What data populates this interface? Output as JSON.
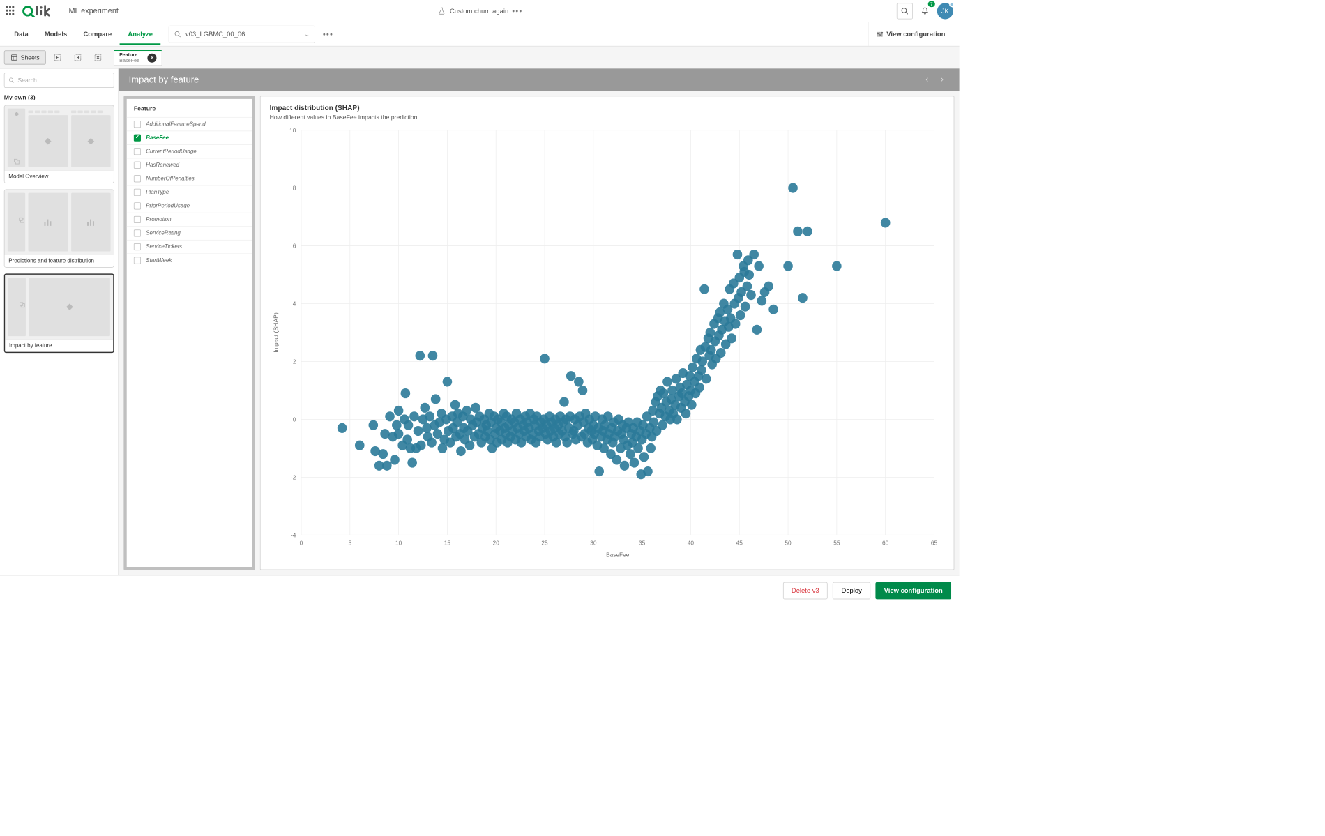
{
  "header": {
    "app_title": "ML experiment",
    "doc_title": "Custom churn again",
    "notification_count": "7",
    "avatar_initials": "JK"
  },
  "tabs": {
    "items": [
      "Data",
      "Models",
      "Compare",
      "Analyze"
    ],
    "active_index": 3,
    "search_value": "v03_LGBMC_00_06",
    "view_config_label": "View configuration"
  },
  "toolbar": {
    "sheets_label": "Sheets",
    "feature_tab_title": "Feature",
    "feature_tab_sub": "BaseFee"
  },
  "sidebar": {
    "search_placeholder": "Search",
    "my_own_label": "My own (3)",
    "sheets": [
      {
        "label": "Model Overview"
      },
      {
        "label": "Predictions and feature distribution"
      },
      {
        "label": "Impact by feature"
      }
    ],
    "active_sheet": 2
  },
  "grey_header": {
    "title": "Impact by feature"
  },
  "feature_panel": {
    "title": "Feature",
    "items": [
      "AdditionalFeatureSpend",
      "BaseFee",
      "CurrentPeriodUsage",
      "HasRenewed",
      "NumberOfPenalties",
      "PlanType",
      "PriorPeriodUsage",
      "Promotion",
      "ServiceRating",
      "ServiceTickets",
      "StartWeek"
    ],
    "selected": "BaseFee"
  },
  "chart": {
    "title": "Impact distribution (SHAP)",
    "subtitle": "How different values in BaseFee impacts the prediction.",
    "xlabel": "BaseFee",
    "ylabel": "Impact (SHAP)"
  },
  "footer": {
    "delete_label": "Delete v3",
    "deploy_label": "Deploy",
    "view_config_label": "View configuration"
  },
  "chart_data": {
    "type": "scatter",
    "title": "Impact distribution (SHAP)",
    "xlabel": "BaseFee",
    "ylabel": "Impact (SHAP)",
    "xlim": [
      0,
      65
    ],
    "ylim": [
      -4,
      10
    ],
    "xticks": [
      0,
      5,
      10,
      15,
      20,
      25,
      30,
      35,
      40,
      45,
      50,
      55,
      60,
      65
    ],
    "yticks": [
      -4,
      -2,
      0,
      2,
      4,
      6,
      8,
      10
    ],
    "point_color": "#2b7a99",
    "points": [
      [
        4.2,
        -0.3
      ],
      [
        6.0,
        -0.9
      ],
      [
        7.4,
        -0.2
      ],
      [
        7.6,
        -1.1
      ],
      [
        8.0,
        -1.6
      ],
      [
        8.4,
        -1.2
      ],
      [
        8.6,
        -0.5
      ],
      [
        8.8,
        -1.6
      ],
      [
        9.1,
        0.1
      ],
      [
        9.4,
        -0.6
      ],
      [
        9.6,
        -1.4
      ],
      [
        9.8,
        -0.2
      ],
      [
        10,
        -0.5
      ],
      [
        10,
        0.3
      ],
      [
        10.4,
        -0.9
      ],
      [
        10.6,
        0.0
      ],
      [
        10.7,
        0.9
      ],
      [
        10.9,
        -0.7
      ],
      [
        11,
        -0.2
      ],
      [
        11.2,
        -1.0
      ],
      [
        11.4,
        -1.5
      ],
      [
        11.6,
        0.1
      ],
      [
        11.8,
        -1.0
      ],
      [
        12,
        -0.4
      ],
      [
        12.2,
        2.2
      ],
      [
        12.3,
        -0.9
      ],
      [
        12.5,
        0.0
      ],
      [
        12.7,
        0.4
      ],
      [
        12.9,
        -0.3
      ],
      [
        13,
        -0.6
      ],
      [
        13.2,
        0.1
      ],
      [
        13.4,
        -0.8
      ],
      [
        13.5,
        2.2
      ],
      [
        13.7,
        -0.2
      ],
      [
        13.8,
        0.7
      ],
      [
        14,
        -0.5
      ],
      [
        14.2,
        -0.1
      ],
      [
        14.4,
        0.2
      ],
      [
        14.5,
        -1.0
      ],
      [
        14.7,
        -0.7
      ],
      [
        14.9,
        0.0
      ],
      [
        15,
        1.3
      ],
      [
        15.1,
        -0.4
      ],
      [
        15.3,
        -0.8
      ],
      [
        15.5,
        0.1
      ],
      [
        15.6,
        -0.3
      ],
      [
        15.8,
        0.5
      ],
      [
        15.9,
        -0.6
      ],
      [
        16,
        -0.1
      ],
      [
        16.1,
        0.2
      ],
      [
        16.3,
        -0.5
      ],
      [
        16.4,
        -1.1
      ],
      [
        16.6,
        0.1
      ],
      [
        16.7,
        -0.3
      ],
      [
        16.8,
        -0.7
      ],
      [
        17,
        0.3
      ],
      [
        17.1,
        -0.4
      ],
      [
        17.3,
        -0.9
      ],
      [
        17.4,
        0.0
      ],
      [
        17.6,
        -0.2
      ],
      [
        17.8,
        -0.6
      ],
      [
        17.9,
        0.4
      ],
      [
        18,
        -0.1
      ],
      [
        18.2,
        -0.5
      ],
      [
        18.3,
        0.1
      ],
      [
        18.5,
        -0.8
      ],
      [
        18.6,
        -0.3
      ],
      [
        18.8,
        0.0
      ],
      [
        18.9,
        -0.6
      ],
      [
        19,
        -0.2
      ],
      [
        19.1,
        -0.4
      ],
      [
        19.3,
        0.2
      ],
      [
        19.4,
        -0.7
      ],
      [
        19.5,
        -0.1
      ],
      [
        19.6,
        -1.0
      ],
      [
        19.8,
        0.1
      ],
      [
        19.9,
        -0.5
      ],
      [
        20,
        -0.3
      ],
      [
        20.1,
        -0.8
      ],
      [
        20.2,
        0.0
      ],
      [
        20.4,
        -0.4
      ],
      [
        20.5,
        -0.1
      ],
      [
        20.6,
        -0.7
      ],
      [
        20.8,
        0.2
      ],
      [
        20.9,
        -0.3
      ],
      [
        21,
        -0.5
      ],
      [
        21.1,
        0.1
      ],
      [
        21.2,
        -0.8
      ],
      [
        21.3,
        -0.2
      ],
      [
        21.5,
        -0.6
      ],
      [
        21.6,
        0.0
      ],
      [
        21.7,
        -0.4
      ],
      [
        21.9,
        -0.1
      ],
      [
        22,
        -0.7
      ],
      [
        22.1,
        0.2
      ],
      [
        22.2,
        -0.3
      ],
      [
        22.4,
        -0.5
      ],
      [
        22.5,
        0.0
      ],
      [
        22.6,
        -0.8
      ],
      [
        22.8,
        -0.2
      ],
      [
        22.9,
        -0.4
      ],
      [
        23,
        0.1
      ],
      [
        23.1,
        -0.6
      ],
      [
        23.2,
        -0.1
      ],
      [
        23.4,
        -0.3
      ],
      [
        23.5,
        0.2
      ],
      [
        23.6,
        -0.7
      ],
      [
        23.8,
        -0.5
      ],
      [
        23.9,
        0.0
      ],
      [
        24,
        -0.2
      ],
      [
        24.1,
        -0.8
      ],
      [
        24.2,
        0.1
      ],
      [
        24.4,
        -0.4
      ],
      [
        24.5,
        -0.6
      ],
      [
        24.6,
        -0.1
      ],
      [
        24.8,
        -0.3
      ],
      [
        24.9,
        0.0
      ],
      [
        25,
        2.1
      ],
      [
        25.1,
        -0.5
      ],
      [
        25.2,
        -0.2
      ],
      [
        25.3,
        -0.7
      ],
      [
        25.5,
        0.1
      ],
      [
        25.6,
        -0.4
      ],
      [
        25.7,
        -0.1
      ],
      [
        25.9,
        -0.6
      ],
      [
        26,
        -0.3
      ],
      [
        26.1,
        0.0
      ],
      [
        26.2,
        -0.8
      ],
      [
        26.4,
        -0.2
      ],
      [
        26.5,
        -0.5
      ],
      [
        26.6,
        0.1
      ],
      [
        26.8,
        -0.4
      ],
      [
        26.9,
        -0.1
      ],
      [
        27,
        0.6
      ],
      [
        27.1,
        -0.6
      ],
      [
        27.2,
        0.0
      ],
      [
        27.3,
        -0.8
      ],
      [
        27.5,
        -0.3
      ],
      [
        27.6,
        0.1
      ],
      [
        27.7,
        1.5
      ],
      [
        27.9,
        -0.5
      ],
      [
        28,
        -0.4
      ],
      [
        28.1,
        0.0
      ],
      [
        28.2,
        -0.7
      ],
      [
        28.4,
        -0.2
      ],
      [
        28.5,
        1.3
      ],
      [
        28.6,
        0.1
      ],
      [
        28.8,
        -0.6
      ],
      [
        28.9,
        1.0
      ],
      [
        29,
        -0.1
      ],
      [
        29.1,
        -0.5
      ],
      [
        29.2,
        0.2
      ],
      [
        29.4,
        -0.8
      ],
      [
        29.5,
        -0.3
      ],
      [
        29.6,
        0.0
      ],
      [
        29.8,
        -0.4
      ],
      [
        29.9,
        -0.7
      ],
      [
        30,
        -0.2
      ],
      [
        30.1,
        -0.5
      ],
      [
        30.2,
        0.1
      ],
      [
        30.4,
        -0.9
      ],
      [
        30.5,
        -0.3
      ],
      [
        30.6,
        -1.8
      ],
      [
        30.8,
        -0.6
      ],
      [
        30.9,
        0.0
      ],
      [
        31,
        -0.4
      ],
      [
        31.1,
        -1.0
      ],
      [
        31.2,
        -0.2
      ],
      [
        31.4,
        -0.7
      ],
      [
        31.5,
        0.1
      ],
      [
        31.6,
        -0.5
      ],
      [
        31.8,
        -1.2
      ],
      [
        31.9,
        -0.3
      ],
      [
        32,
        -0.8
      ],
      [
        32.1,
        -0.1
      ],
      [
        32.2,
        -0.6
      ],
      [
        32.4,
        -1.4
      ],
      [
        32.5,
        -0.4
      ],
      [
        32.6,
        0.0
      ],
      [
        32.8,
        -1.0
      ],
      [
        32.9,
        -0.5
      ],
      [
        33,
        -0.2
      ],
      [
        33.1,
        -0.7
      ],
      [
        33.2,
        -1.6
      ],
      [
        33.4,
        -0.3
      ],
      [
        33.5,
        -0.9
      ],
      [
        33.6,
        -0.1
      ],
      [
        33.8,
        -1.2
      ],
      [
        33.9,
        -0.5
      ],
      [
        34,
        -0.8
      ],
      [
        34.1,
        -0.3
      ],
      [
        34.2,
        -1.5
      ],
      [
        34.4,
        -0.6
      ],
      [
        34.5,
        -0.1
      ],
      [
        34.6,
        -1.0
      ],
      [
        34.8,
        -0.4
      ],
      [
        34.9,
        -1.9
      ],
      [
        35,
        -0.7
      ],
      [
        35.1,
        -0.2
      ],
      [
        35.2,
        -1.3
      ],
      [
        35.4,
        -0.5
      ],
      [
        35.5,
        0.1
      ],
      [
        35.6,
        -1.8
      ],
      [
        35.8,
        -0.3
      ],
      [
        35.9,
        -1.0
      ],
      [
        36,
        -0.6
      ],
      [
        36.1,
        0.3
      ],
      [
        36.2,
        -0.1
      ],
      [
        36.4,
        0.6
      ],
      [
        36.5,
        -0.4
      ],
      [
        36.6,
        0.8
      ],
      [
        36.8,
        0.2
      ],
      [
        36.9,
        1.0
      ],
      [
        37,
        0.4
      ],
      [
        37.1,
        -0.2
      ],
      [
        37.2,
        0.9
      ],
      [
        37.4,
        0.1
      ],
      [
        37.5,
        0.6
      ],
      [
        37.6,
        1.3
      ],
      [
        37.8,
        0.3
      ],
      [
        37.9,
        0.0
      ],
      [
        38,
        0.7
      ],
      [
        38.1,
        1.0
      ],
      [
        38.2,
        0.2
      ],
      [
        38.4,
        0.5
      ],
      [
        38.5,
        1.4
      ],
      [
        38.6,
        0.0
      ],
      [
        38.8,
        0.8
      ],
      [
        38.9,
        1.1
      ],
      [
        39,
        0.4
      ],
      [
        39.1,
        0.9
      ],
      [
        39.2,
        1.6
      ],
      [
        39.4,
        0.6
      ],
      [
        39.5,
        0.2
      ],
      [
        39.6,
        1.2
      ],
      [
        39.8,
        0.8
      ],
      [
        39.9,
        1.5
      ],
      [
        40,
        1.0
      ],
      [
        40.1,
        0.5
      ],
      [
        40.2,
        1.8
      ],
      [
        40.4,
        1.3
      ],
      [
        40.5,
        0.9
      ],
      [
        40.6,
        2.1
      ],
      [
        40.8,
        1.5
      ],
      [
        40.9,
        1.1
      ],
      [
        41,
        2.4
      ],
      [
        41.1,
        1.7
      ],
      [
        41.2,
        2.0
      ],
      [
        41.4,
        4.5
      ],
      [
        41.5,
        2.5
      ],
      [
        41.6,
        1.4
      ],
      [
        41.8,
        2.8
      ],
      [
        41.9,
        2.2
      ],
      [
        42,
        3.0
      ],
      [
        42.1,
        2.4
      ],
      [
        42.2,
        1.9
      ],
      [
        42.4,
        3.3
      ],
      [
        42.5,
        2.7
      ],
      [
        42.6,
        2.1
      ],
      [
        42.8,
        3.5
      ],
      [
        42.9,
        2.9
      ],
      [
        43,
        3.7
      ],
      [
        43.1,
        2.3
      ],
      [
        43.2,
        3.1
      ],
      [
        43.4,
        4.0
      ],
      [
        43.5,
        3.4
      ],
      [
        43.6,
        2.6
      ],
      [
        43.8,
        3.8
      ],
      [
        43.9,
        3.2
      ],
      [
        44,
        4.5
      ],
      [
        44.1,
        3.5
      ],
      [
        44.2,
        2.8
      ],
      [
        44.4,
        4.7
      ],
      [
        44.5,
        4.0
      ],
      [
        44.6,
        3.3
      ],
      [
        44.8,
        5.7
      ],
      [
        44.9,
        4.2
      ],
      [
        45,
        4.9
      ],
      [
        45.1,
        3.6
      ],
      [
        45.2,
        4.4
      ],
      [
        45.4,
        5.3
      ],
      [
        45.5,
        5.1
      ],
      [
        45.6,
        3.9
      ],
      [
        45.8,
        4.6
      ],
      [
        45.9,
        5.5
      ],
      [
        46,
        5.0
      ],
      [
        46.2,
        4.3
      ],
      [
        46.5,
        5.7
      ],
      [
        46.8,
        3.1
      ],
      [
        47,
        5.3
      ],
      [
        47.3,
        4.1
      ],
      [
        47.6,
        4.4
      ],
      [
        48,
        4.6
      ],
      [
        48.5,
        3.8
      ],
      [
        50,
        5.3
      ],
      [
        50.5,
        8.0
      ],
      [
        51,
        6.5
      ],
      [
        51.5,
        4.2
      ],
      [
        52,
        6.5
      ],
      [
        55,
        5.3
      ],
      [
        60,
        6.8
      ]
    ]
  }
}
